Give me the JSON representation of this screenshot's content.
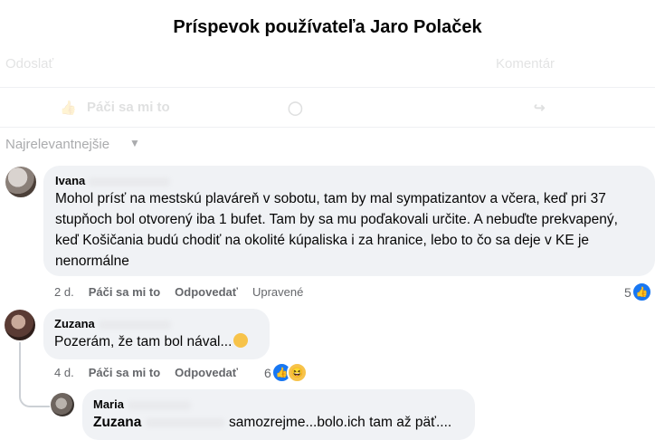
{
  "header": {
    "title": "Príspevok používateľa Jaro Polaček"
  },
  "faded": {
    "left_text": "Odoslať",
    "comment": "Komentár",
    "like": "Páči sa mi to",
    "share": "Zdieľať",
    "sort": "Najrelevantnejšie"
  },
  "comments": [
    {
      "author": "Ivana",
      "text": "Mohol prísť na mestskú plaváreň v sobotu, tam by mal sympatizantov a včera, keď pri 37 stupňoch bol otvorený iba 1 bufet. Tam by sa mu poďakovali určite. A nebuďte prekvapený, keď Košičania budú chodiť na okolité kúpaliska i za hranice, lebo to čo sa deje v KE je nenormálne",
      "time": "2 d.",
      "like_label": "Páči sa mi to",
      "reply_label": "Odpovedať",
      "edited": "Upravené",
      "reactions": "5"
    },
    {
      "author": "Zuzana",
      "text": "Pozerám, že tam bol nával...",
      "time": "4 d.",
      "like_label": "Páči sa mi to",
      "reply_label": "Odpovedať",
      "reactions": "6"
    },
    {
      "author": "Maria",
      "mention": "Zuzana",
      "text": "samozrejme...bolo.ich tam až päť...."
    }
  ]
}
